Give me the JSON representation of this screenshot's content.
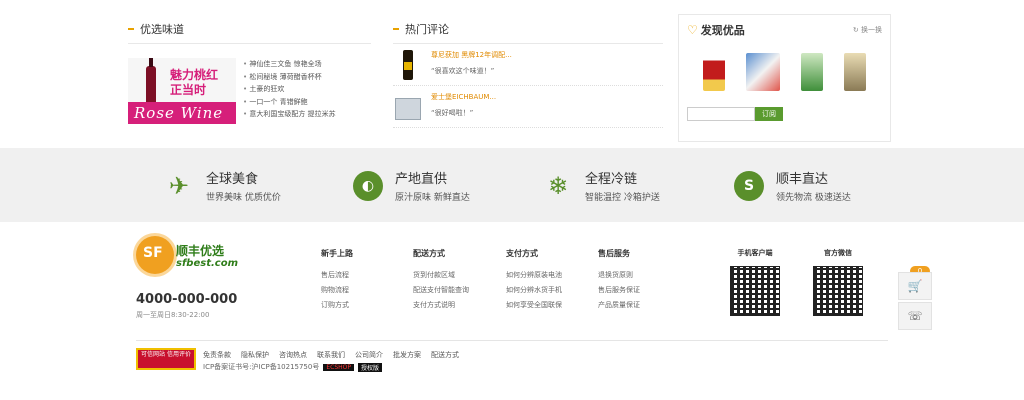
{
  "panels": {
    "preferred": {
      "title": "优选味道",
      "promo_line1": "魅力桃红",
      "promo_line2": "正当时",
      "promo_script": "Rose Wine",
      "items": [
        "神仙佳三文鱼 惊艳全场",
        "松间秘境 薄荷醋香杯杯",
        "土豪的狂欢",
        "一口一个 青错鲜鲍",
        "意大利国宝级配方 提拉米苏"
      ]
    },
    "reviews": {
      "title": "热门评论",
      "items": [
        {
          "name": "尊尼获加 黑牌12年调配...",
          "quote": "“很喜欢这个味道！”"
        },
        {
          "name": "爱士堡EICHBAUM...",
          "quote": "“很好喝啦！”"
        }
      ]
    },
    "discover": {
      "title": "发现优品",
      "refresh": "换一换",
      "button": "订阅",
      "input_value": ""
    }
  },
  "features": [
    {
      "title": "全球美食",
      "sub": "世界美味 优质优价",
      "icon": "plane-icon"
    },
    {
      "title": "产地直供",
      "sub": "原汁原味 新鲜直达",
      "icon": "globe-icon"
    },
    {
      "title": "全程冷链",
      "sub": "智能温控 冷箱护送",
      "icon": "snowflake-icon"
    },
    {
      "title": "顺丰直达",
      "sub": "领先物流 极速送达",
      "icon": "sf-icon"
    }
  ],
  "footer": {
    "logo_cn": "顺丰优选",
    "logo_url": "sfbest.com",
    "logo_mark": "SF",
    "phone": "4000-000-000",
    "hours": "周一至周日8:30-22:00",
    "columns": [
      {
        "title": "新手上路",
        "links": [
          "售后流程",
          "购物流程",
          "订购方式"
        ]
      },
      {
        "title": "配送方式",
        "links": [
          "货到付款区域",
          "配送支付智能查询",
          "支付方式说明"
        ]
      },
      {
        "title": "支付方式",
        "links": [
          "如何分辨原装电池",
          "如何分辨水货手机",
          "如何享受全国联保"
        ]
      },
      {
        "title": "售后服务",
        "links": [
          "退换货原则",
          "售后服务保证",
          "产品质量保证"
        ]
      }
    ],
    "qr": [
      {
        "title": "手机客户端"
      },
      {
        "title": "官方微信"
      }
    ],
    "cart_count": "0",
    "trust_badge": "可信网站 信用评价",
    "links": [
      "免责条款",
      "隐私保护",
      "咨询热点",
      "联系我们",
      "公司简介",
      "批发方案",
      "配送方式"
    ],
    "icp": "ICP备案证书号:沪ICP备10215750号",
    "icp_tags": [
      "ECSHOP",
      "授权版"
    ]
  }
}
